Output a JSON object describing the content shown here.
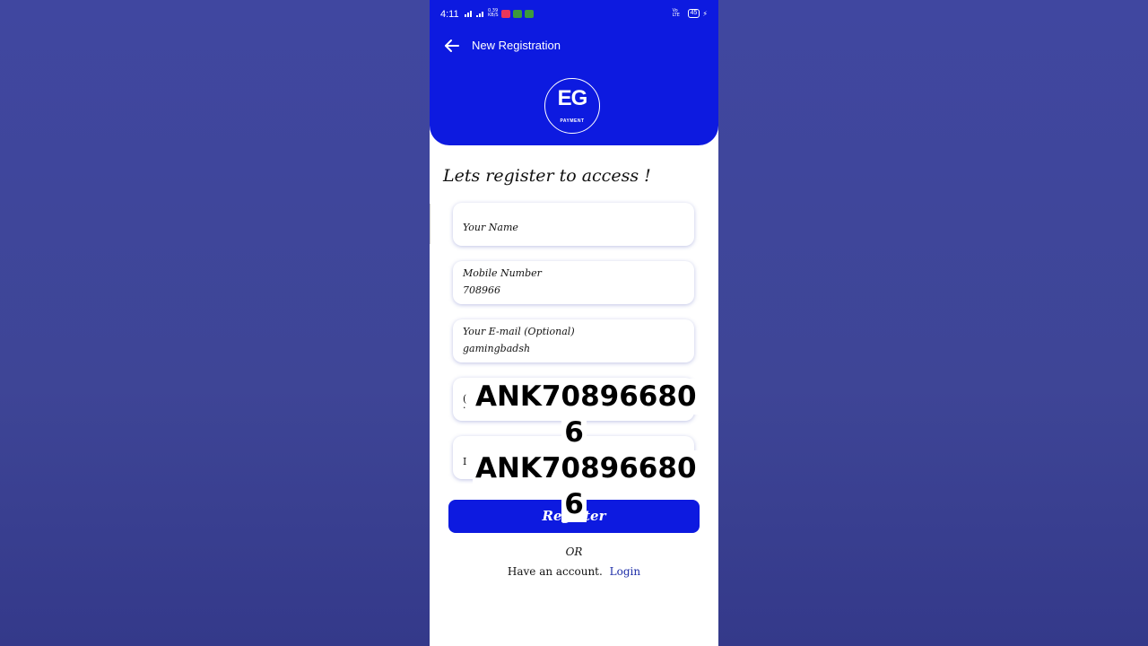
{
  "status_bar": {
    "time": "4:11",
    "speed_value": "0.39",
    "speed_unit": "KB/S",
    "network_label": "Vo LTE",
    "battery": "45"
  },
  "header": {
    "title": "New Registration",
    "logo_letters": "EG",
    "logo_sub": "PAYMENT"
  },
  "form": {
    "heading": "Lets register to access !",
    "fields": [
      {
        "label": "",
        "value": "",
        "placeholder": "Your Name"
      },
      {
        "label": "Mobile Number",
        "value": "708966"
      },
      {
        "label": "Your E-mail (Optional)",
        "value": "gamingbadsh"
      },
      {
        "label": "(",
        "value": "·"
      },
      {
        "label": "I",
        "value": ""
      }
    ],
    "submit_label": "Register"
  },
  "overlay": {
    "line1": "ANK70896680",
    "line2": "6",
    "line3": "ANK70896680",
    "line4": "6"
  },
  "footer": {
    "or_text": "OR",
    "have_account": "Have an account.",
    "login_label": "Login"
  },
  "colors": {
    "brand_blue": "#0d1ae0",
    "backdrop": "#3f4799",
    "link": "#1e2ea8"
  }
}
